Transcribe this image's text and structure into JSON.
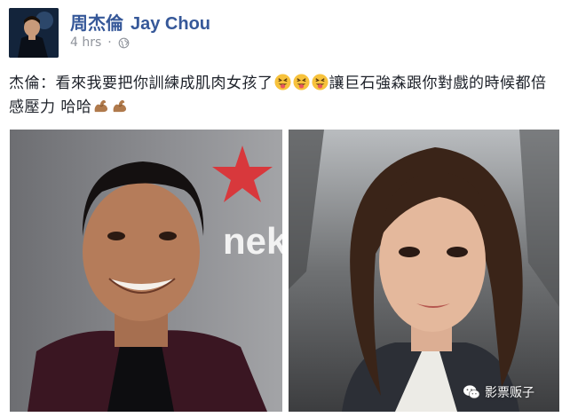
{
  "post": {
    "author_cn": "周杰倫",
    "author_en": "Jay Chou",
    "time": "4 hrs",
    "privacy_icon": "globe-icon",
    "text_part1": "杰倫：看來我要把你訓練成肌肉女孩了",
    "text_part2": "讓巨石強森跟你對戲的時候都倍感壓力 哈哈",
    "emojis": [
      "squinting-tongue-emoji",
      "squinting-tongue-emoji",
      "squinting-tongue-emoji"
    ],
    "flex_emojis": [
      "flexed-biceps-emoji",
      "flexed-biceps-emoji"
    ]
  },
  "photos": {
    "left": "man-smiling-photo",
    "right": "woman-portrait-photo"
  },
  "watermark": {
    "text": "影票贩子",
    "icon": "wechat-icon"
  },
  "colors": {
    "author_link": "#365899",
    "meta_gray": "#90949c",
    "text": "#1d2129"
  }
}
